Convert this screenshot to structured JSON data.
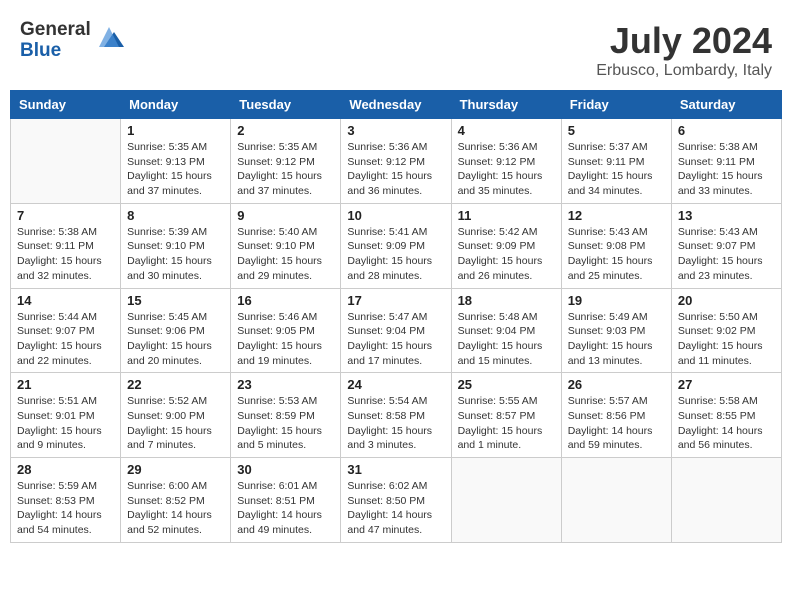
{
  "header": {
    "logo_general": "General",
    "logo_blue": "Blue",
    "month": "July 2024",
    "location": "Erbusco, Lombardy, Italy"
  },
  "weekdays": [
    "Sunday",
    "Monday",
    "Tuesday",
    "Wednesday",
    "Thursday",
    "Friday",
    "Saturday"
  ],
  "weeks": [
    [
      {
        "day": "",
        "info": ""
      },
      {
        "day": "1",
        "info": "Sunrise: 5:35 AM\nSunset: 9:13 PM\nDaylight: 15 hours\nand 37 minutes."
      },
      {
        "day": "2",
        "info": "Sunrise: 5:35 AM\nSunset: 9:12 PM\nDaylight: 15 hours\nand 37 minutes."
      },
      {
        "day": "3",
        "info": "Sunrise: 5:36 AM\nSunset: 9:12 PM\nDaylight: 15 hours\nand 36 minutes."
      },
      {
        "day": "4",
        "info": "Sunrise: 5:36 AM\nSunset: 9:12 PM\nDaylight: 15 hours\nand 35 minutes."
      },
      {
        "day": "5",
        "info": "Sunrise: 5:37 AM\nSunset: 9:11 PM\nDaylight: 15 hours\nand 34 minutes."
      },
      {
        "day": "6",
        "info": "Sunrise: 5:38 AM\nSunset: 9:11 PM\nDaylight: 15 hours\nand 33 minutes."
      }
    ],
    [
      {
        "day": "7",
        "info": "Sunrise: 5:38 AM\nSunset: 9:11 PM\nDaylight: 15 hours\nand 32 minutes."
      },
      {
        "day": "8",
        "info": "Sunrise: 5:39 AM\nSunset: 9:10 PM\nDaylight: 15 hours\nand 30 minutes."
      },
      {
        "day": "9",
        "info": "Sunrise: 5:40 AM\nSunset: 9:10 PM\nDaylight: 15 hours\nand 29 minutes."
      },
      {
        "day": "10",
        "info": "Sunrise: 5:41 AM\nSunset: 9:09 PM\nDaylight: 15 hours\nand 28 minutes."
      },
      {
        "day": "11",
        "info": "Sunrise: 5:42 AM\nSunset: 9:09 PM\nDaylight: 15 hours\nand 26 minutes."
      },
      {
        "day": "12",
        "info": "Sunrise: 5:43 AM\nSunset: 9:08 PM\nDaylight: 15 hours\nand 25 minutes."
      },
      {
        "day": "13",
        "info": "Sunrise: 5:43 AM\nSunset: 9:07 PM\nDaylight: 15 hours\nand 23 minutes."
      }
    ],
    [
      {
        "day": "14",
        "info": "Sunrise: 5:44 AM\nSunset: 9:07 PM\nDaylight: 15 hours\nand 22 minutes."
      },
      {
        "day": "15",
        "info": "Sunrise: 5:45 AM\nSunset: 9:06 PM\nDaylight: 15 hours\nand 20 minutes."
      },
      {
        "day": "16",
        "info": "Sunrise: 5:46 AM\nSunset: 9:05 PM\nDaylight: 15 hours\nand 19 minutes."
      },
      {
        "day": "17",
        "info": "Sunrise: 5:47 AM\nSunset: 9:04 PM\nDaylight: 15 hours\nand 17 minutes."
      },
      {
        "day": "18",
        "info": "Sunrise: 5:48 AM\nSunset: 9:04 PM\nDaylight: 15 hours\nand 15 minutes."
      },
      {
        "day": "19",
        "info": "Sunrise: 5:49 AM\nSunset: 9:03 PM\nDaylight: 15 hours\nand 13 minutes."
      },
      {
        "day": "20",
        "info": "Sunrise: 5:50 AM\nSunset: 9:02 PM\nDaylight: 15 hours\nand 11 minutes."
      }
    ],
    [
      {
        "day": "21",
        "info": "Sunrise: 5:51 AM\nSunset: 9:01 PM\nDaylight: 15 hours\nand 9 minutes."
      },
      {
        "day": "22",
        "info": "Sunrise: 5:52 AM\nSunset: 9:00 PM\nDaylight: 15 hours\nand 7 minutes."
      },
      {
        "day": "23",
        "info": "Sunrise: 5:53 AM\nSunset: 8:59 PM\nDaylight: 15 hours\nand 5 minutes."
      },
      {
        "day": "24",
        "info": "Sunrise: 5:54 AM\nSunset: 8:58 PM\nDaylight: 15 hours\nand 3 minutes."
      },
      {
        "day": "25",
        "info": "Sunrise: 5:55 AM\nSunset: 8:57 PM\nDaylight: 15 hours\nand 1 minute."
      },
      {
        "day": "26",
        "info": "Sunrise: 5:57 AM\nSunset: 8:56 PM\nDaylight: 14 hours\nand 59 minutes."
      },
      {
        "day": "27",
        "info": "Sunrise: 5:58 AM\nSunset: 8:55 PM\nDaylight: 14 hours\nand 56 minutes."
      }
    ],
    [
      {
        "day": "28",
        "info": "Sunrise: 5:59 AM\nSunset: 8:53 PM\nDaylight: 14 hours\nand 54 minutes."
      },
      {
        "day": "29",
        "info": "Sunrise: 6:00 AM\nSunset: 8:52 PM\nDaylight: 14 hours\nand 52 minutes."
      },
      {
        "day": "30",
        "info": "Sunrise: 6:01 AM\nSunset: 8:51 PM\nDaylight: 14 hours\nand 49 minutes."
      },
      {
        "day": "31",
        "info": "Sunrise: 6:02 AM\nSunset: 8:50 PM\nDaylight: 14 hours\nand 47 minutes."
      },
      {
        "day": "",
        "info": ""
      },
      {
        "day": "",
        "info": ""
      },
      {
        "day": "",
        "info": ""
      }
    ]
  ]
}
